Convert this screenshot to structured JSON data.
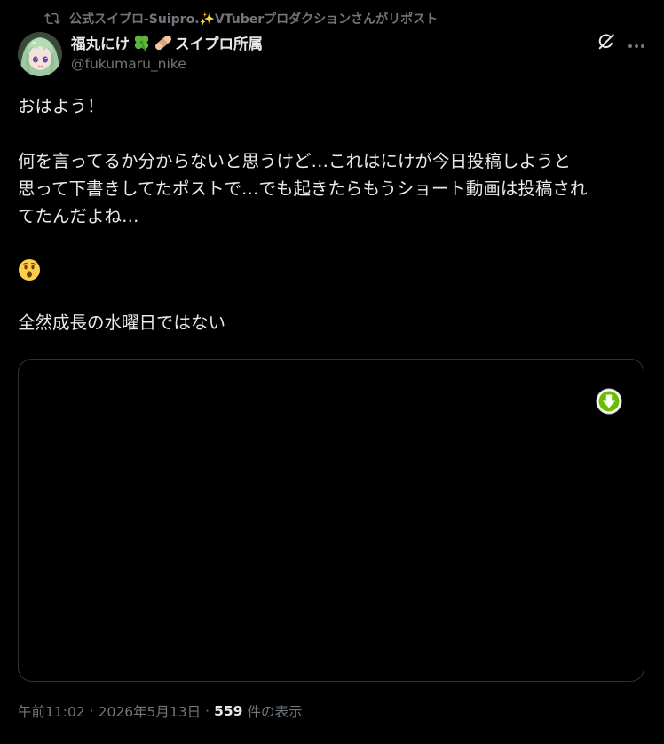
{
  "repost": {
    "text": "公式スイプロ-Suipro.✨VTuberプロダクションさんがリポスト",
    "icon": "repost-icon"
  },
  "author": {
    "name_part1": "福丸にけ",
    "name_part2": "スイプロ所属",
    "name_emojis": [
      "four-leaf-clover-icon",
      "bandage-icon"
    ],
    "handle": "@fukumaru_nike",
    "avatar": "avatar-anime-girl-green-hair"
  },
  "actions": {
    "grok_icon": "grok-icon",
    "more_icon": "more-dots-icon"
  },
  "tweet": {
    "line1": "おはよう！",
    "line2": "何を言ってるか分からないと思うけど…これはにけが今日投稿しようと",
    "line3": "思って下書きしてたポストで…でも起きたらもうショート動画は投稿され",
    "line4": "てたんだよね…",
    "emoji": "hushed-face-emoji",
    "line5": "全然成長の水曜日ではない"
  },
  "media": {
    "type": "video",
    "download_icon": "download-arrow-icon"
  },
  "meta": {
    "time": "午前11:02",
    "date": "2026年5月13日",
    "dot": "·",
    "views": "559",
    "views_label": "件の表示"
  },
  "colors": {
    "background": "#000000",
    "text_primary": "#e7e9ea",
    "text_secondary": "#71767b",
    "border": "#2f3336",
    "download_green": "#6abe00"
  }
}
